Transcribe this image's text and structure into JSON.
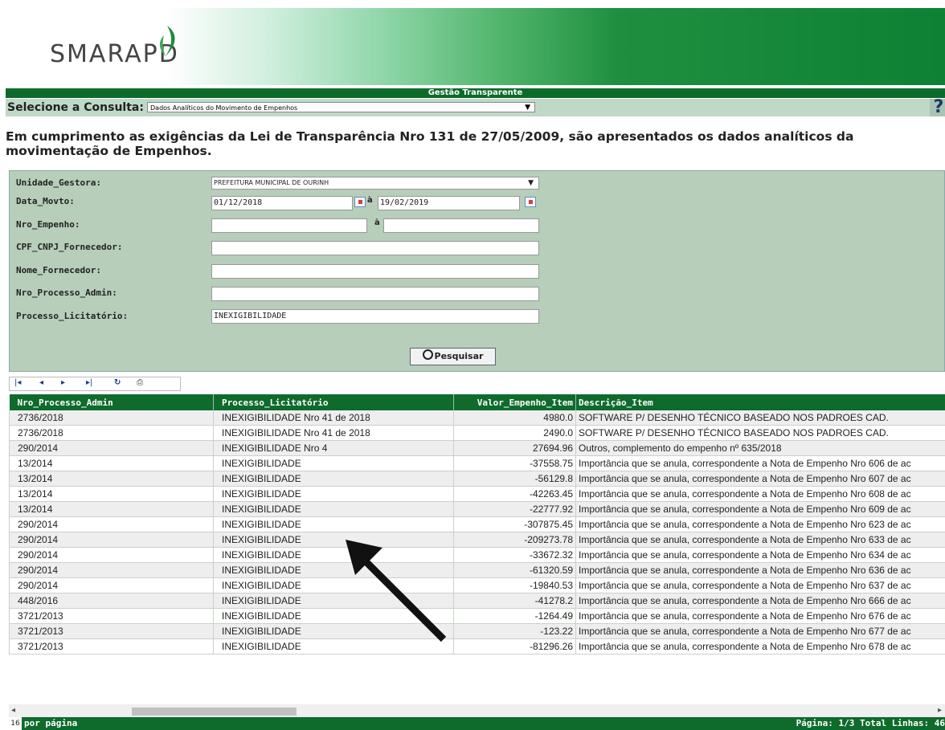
{
  "header": {
    "logo_text": "SMARAPD",
    "title": "Gestão Transparente"
  },
  "consulta": {
    "label": "Selecione a Consulta:",
    "selected": "Dados Analíticos do Movimento de Empenhos",
    "help_icon": "?"
  },
  "law_text": "Em cumprimento as exigências da Lei de Transparência Nro 131 de 27/05/2009, são apresentados os dados analíticos da movimentação de Empenhos.",
  "filters": {
    "unidade_gestora": {
      "label": "Unidade_Gestora:",
      "value": "PREFEITURA MUNICIPAL DE OURINH"
    },
    "data_movto": {
      "label": "Data_Movto:",
      "from": "01/12/2018",
      "sep": "à",
      "to": "19/02/2019"
    },
    "nro_empenho": {
      "label": "Nro_Empenho:",
      "from": "",
      "sep": "à",
      "to": ""
    },
    "cpf_cnpj": {
      "label": "CPF_CNPJ_Fornecedor:",
      "value": ""
    },
    "nome_fornecedor": {
      "label": "Nome_Fornecedor:",
      "value": ""
    },
    "nro_processo_admin": {
      "label": "Nro_Processo_Admin:",
      "value": ""
    },
    "processo_licitatorio": {
      "label": "Processo_Licitatório:",
      "value": "INEXIGIBILIDADE"
    },
    "search_label": "Pesquisar"
  },
  "toolbar": {
    "first_icon": "first-page-icon",
    "prev_icon": "prev-page-icon",
    "next_icon": "next-page-icon",
    "last_icon": "last-page-icon",
    "refresh_icon": "refresh-icon",
    "print_icon": "print-icon"
  },
  "table": {
    "columns": [
      "Nro_Processo_Admin",
      "Processo_Licitatório",
      "Valor_Empenho_Item",
      "Descrição_Item"
    ],
    "rows": [
      [
        "2736/2018",
        "INEXIGIBILIDADE Nro 41 de 2018",
        "4980.0",
        "SOFTWARE P/ DESENHO TÉCNICO BASEADO NOS PADROES CAD."
      ],
      [
        "2736/2018",
        "INEXIGIBILIDADE Nro 41 de 2018",
        "2490.0",
        "SOFTWARE P/ DESENHO TÉCNICO BASEADO NOS PADROES CAD."
      ],
      [
        "290/2014",
        "INEXIGIBILIDADE Nro 4",
        "27694.96",
        "Outros, complemento do empenho nº 635/2018"
      ],
      [
        "13/2014",
        "INEXIGIBILIDADE",
        "-37558.75",
        "Importância que se anula, correspondente a Nota de Empenho Nro 606 de ac"
      ],
      [
        "13/2014",
        "INEXIGIBILIDADE",
        "-56129.8",
        "Importância que se anula, correspondente a Nota de Empenho Nro 607 de ac"
      ],
      [
        "13/2014",
        "INEXIGIBILIDADE",
        "-42263.45",
        "Importância que se anula, correspondente a Nota de Empenho Nro 608 de ac"
      ],
      [
        "13/2014",
        "INEXIGIBILIDADE",
        "-22777.92",
        "Importância que se anula, correspondente a Nota de Empenho Nro 609 de ac"
      ],
      [
        "290/2014",
        "INEXIGIBILIDADE",
        "-307875.45",
        "Importância que se anula, correspondente a Nota de Empenho Nro 623 de ac"
      ],
      [
        "290/2014",
        "INEXIGIBILIDADE",
        "-209273.78",
        "Importância que se anula, correspondente a Nota de Empenho Nro 633 de ac"
      ],
      [
        "290/2014",
        "INEXIGIBILIDADE",
        "-33672.32",
        "Importância que se anula, correspondente a Nota de Empenho Nro 634 de ac"
      ],
      [
        "290/2014",
        "INEXIGIBILIDADE",
        "-61320.59",
        "Importância que se anula, correspondente a Nota de Empenho Nro 636 de ac"
      ],
      [
        "290/2014",
        "INEXIGIBILIDADE",
        "-19840.53",
        "Importância que se anula, correspondente a Nota de Empenho Nro 637 de ac"
      ],
      [
        "448/2016",
        "INEXIGIBILIDADE",
        "-41278.2",
        "Importância que se anula, correspondente a Nota de Empenho Nro 666 de ac"
      ],
      [
        "3721/2013",
        "INEXIGIBILIDADE",
        "-1264.49",
        "Importância que se anula, correspondente a Nota de Empenho Nro 676 de ac"
      ],
      [
        "3721/2013",
        "INEXIGIBILIDADE",
        "-123.22",
        "Importância que se anula, correspondente a Nota de Empenho Nro 677 de ac"
      ],
      [
        "3721/2013",
        "INEXIGIBILIDADE",
        "-81296.26",
        "Importância que se anula, correspondente a Nota de Empenho Nro 678 de ac"
      ]
    ]
  },
  "footer": {
    "per_page_value": "16",
    "per_page_label": "por página",
    "page_info": "Página: 1/3 Total Linhas: 46"
  },
  "colors": {
    "header_green": "#0e6b2c",
    "panel_green": "#b6ceba",
    "row_alt": "#eeeeee"
  }
}
